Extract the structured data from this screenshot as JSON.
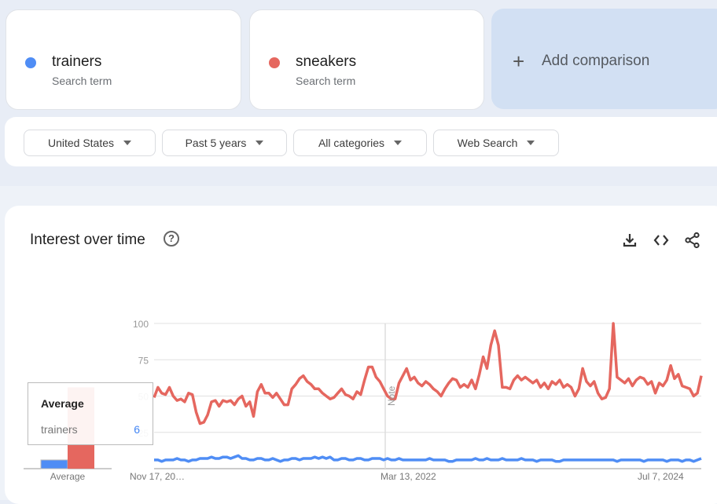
{
  "terms": [
    {
      "name": "trainers",
      "subtitle": "Search term",
      "color": "#4f8df5"
    },
    {
      "name": "sneakers",
      "subtitle": "Search term",
      "color": "#e5675f"
    }
  ],
  "add_comparison": {
    "icon": "plus-icon",
    "label": "Add comparison"
  },
  "filters": [
    {
      "label": "United States"
    },
    {
      "label": "Past 5 years"
    },
    {
      "label": "All categories"
    },
    {
      "label": "Web Search"
    }
  ],
  "panel": {
    "title": "Interest over time",
    "help_icon": "help-circle-icon",
    "tools": [
      "download-icon",
      "embed-code-icon",
      "share-icon"
    ]
  },
  "tooltip": {
    "title": "Average",
    "term": "trainers",
    "value": "6"
  },
  "chart_data": {
    "type": "line",
    "title": "Interest over time",
    "xlabel": "",
    "ylabel": "",
    "ylim": [
      0,
      100
    ],
    "yticks": [
      25,
      50,
      75,
      100
    ],
    "xtick_labels": [
      {
        "label": "Nov 17, 20…",
        "position_fraction": 0.0
      },
      {
        "label": "Mar 13, 2022",
        "position_fraction": 0.42
      },
      {
        "label": "Jul 7, 2024",
        "position_fraction": 0.92
      }
    ],
    "note_marker": {
      "label": "Note",
      "position_fraction": 0.42
    },
    "grid": true,
    "averages": {
      "label": "Average",
      "trainers": 6,
      "sneakers": 56
    },
    "series": [
      {
        "name": "sneakers",
        "color": "#e5675f",
        "values": [
          49,
          56,
          52,
          51,
          56,
          50,
          47,
          48,
          46,
          52,
          51,
          39,
          31,
          32,
          37,
          46,
          47,
          43,
          47,
          46,
          47,
          44,
          48,
          50,
          43,
          46,
          36,
          53,
          58,
          52,
          52,
          49,
          52,
          48,
          44,
          44,
          55,
          58,
          62,
          64,
          60,
          58,
          55,
          55,
          52,
          50,
          48,
          49,
          52,
          55,
          51,
          50,
          48,
          53,
          51,
          61,
          70,
          70,
          63,
          60,
          55,
          50,
          48,
          48,
          59,
          64,
          69,
          61,
          63,
          59,
          57,
          60,
          58,
          55,
          53,
          50,
          55,
          59,
          62,
          61,
          56,
          58,
          56,
          61,
          55,
          65,
          77,
          69,
          85,
          95,
          85,
          56,
          56,
          55,
          61,
          64,
          61,
          63,
          61,
          59,
          61,
          56,
          59,
          55,
          60,
          58,
          61,
          56,
          58,
          56,
          50,
          55,
          69,
          60,
          57,
          60,
          52,
          48,
          49,
          55,
          100,
          63,
          61,
          59,
          62,
          57,
          61,
          63,
          62,
          58,
          60,
          52,
          59,
          57,
          61,
          71,
          62,
          65,
          57,
          56,
          55,
          50,
          52,
          64
        ]
      },
      {
        "name": "trainers",
        "color": "#4f8df5",
        "values": [
          6,
          6,
          5,
          6,
          6,
          6,
          7,
          6,
          6,
          5,
          6,
          6,
          7,
          7,
          7,
          8,
          7,
          7,
          8,
          8,
          7,
          8,
          9,
          7,
          7,
          6,
          6,
          7,
          7,
          6,
          6,
          7,
          6,
          5,
          6,
          6,
          7,
          7,
          6,
          7,
          7,
          7,
          8,
          7,
          8,
          7,
          8,
          6,
          6,
          7,
          7,
          6,
          6,
          7,
          7,
          6,
          6,
          7,
          7,
          7,
          6,
          7,
          6,
          6,
          7,
          6,
          6,
          6,
          6,
          6,
          6,
          6,
          7,
          6,
          6,
          6,
          6,
          5,
          5,
          6,
          6,
          6,
          6,
          6,
          7,
          6,
          6,
          7,
          6,
          6,
          6,
          7,
          6,
          6,
          6,
          6,
          7,
          6,
          6,
          6,
          5,
          6,
          6,
          6,
          6,
          5,
          5,
          6,
          6,
          6,
          6,
          6,
          6,
          6,
          6,
          6,
          6,
          6,
          6,
          6,
          6,
          5,
          6,
          6,
          6,
          6,
          6,
          6,
          5,
          6,
          6,
          6,
          6,
          6,
          5,
          6,
          6,
          6,
          5,
          6,
          6,
          5,
          6,
          7
        ]
      }
    ]
  }
}
